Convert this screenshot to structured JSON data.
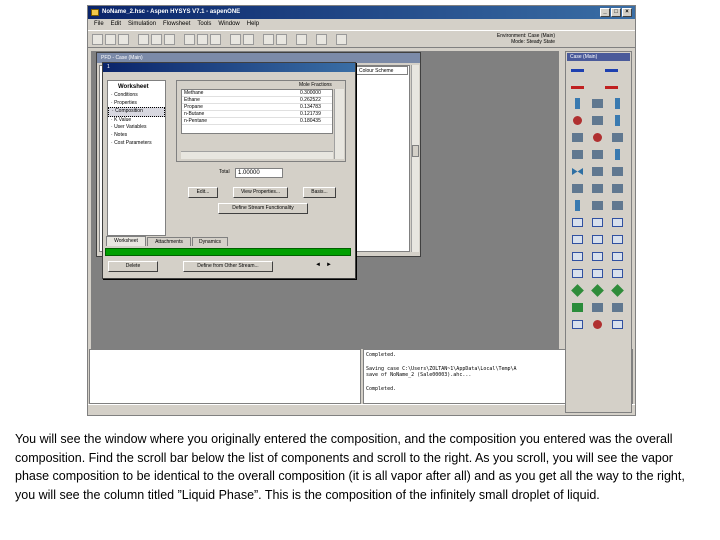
{
  "window": {
    "title": "NoName_2.hsc - Aspen HYSYS V7.1 - aspenONE"
  },
  "menu": [
    "File",
    "Edit",
    "Simulation",
    "Flowsheet",
    "Tools",
    "Window",
    "Help"
  ],
  "environment": {
    "line1": "Environment: Case (Main)",
    "line2": "Mode: Steady State"
  },
  "pfd": {
    "title": "PFD - Case (Main)",
    "colour_scheme": "Colour Scheme"
  },
  "stream_window": {
    "title": "1",
    "nav_header": "Worksheet",
    "nav_items": [
      "Conditions",
      "Properties",
      "Composition",
      "K Value",
      "User Variables",
      "Notes",
      "Cost Parameters"
    ],
    "grid_header": "Mole Fractions",
    "components": [
      {
        "name": "Methane",
        "value": "0.300000"
      },
      {
        "name": "Ethane",
        "value": "0.262522"
      },
      {
        "name": "Propane",
        "value": "0.134783"
      },
      {
        "name": "n-Butane",
        "value": "0.121739"
      },
      {
        "name": "n-Pentane",
        "value": "0.180435"
      }
    ],
    "total_label": "Total",
    "total_value": "1.00000",
    "buttons": {
      "edit": "Edit...",
      "view_properties": "View Properties...",
      "basis": "Basis...",
      "normalize": "Define Stream Functionality"
    },
    "tabs": [
      "Worksheet",
      "Attachments",
      "Dynamics"
    ],
    "footer": {
      "delete": "Delete",
      "define": "Define from Other Stream...",
      "nav": [
        "◄",
        "►"
      ]
    }
  },
  "messages": [
    "Completed.",
    "",
    "Saving case C:\\Users\\ZOLTAN~1\\AppData\\Local\\Temp\\A",
    "save of NoName_2 (Sale00003).ahc...",
    "",
    "Completed."
  ],
  "palette": {
    "title": "Case (Main)"
  },
  "caption": "You will see the window where you originally entered the composition, and the composition you entered was the overall composition. Find the scroll bar below the list of components and scroll to the right. As you scroll, you will see the vapor phase composition to be identical to the overall composition (it is all vapor after all) and as you get all the way to the right, you will see the column titled ”Liquid Phase”. This is the composition of the infinitely small droplet of liquid."
}
